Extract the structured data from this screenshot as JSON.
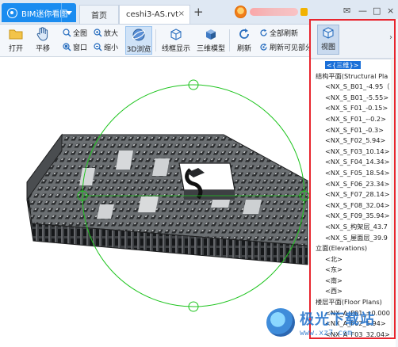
{
  "colors": {
    "accent": "#1a8cf0",
    "highlight_border": "#e8252e",
    "selection": "#1a6fd8",
    "nav_circle": "#1ec41e"
  },
  "titlebar": {
    "app_title": "BIM迷你看图",
    "tabs": [
      {
        "label": "首页"
      },
      {
        "label": "ceshi3-AS.rvt"
      }
    ],
    "add_tab_label": "+",
    "close_label": "×",
    "dropdown_icon": "chevron-down-icon",
    "window_controls": [
      "—",
      "□",
      "×"
    ]
  },
  "toolbar": {
    "open": "打开",
    "pan": "平移",
    "fit_all": "全图",
    "window_zoom": "窗口",
    "zoom_in": "放大",
    "zoom_out": "缩小",
    "browse_3d": "3D浏览",
    "wireframe": "线框显示",
    "model_3d": "三维模型",
    "refresh": "刷新",
    "refresh_all": "全部刷新",
    "refresh_visible": "刷新可见部分"
  },
  "panel": {
    "view_button": "视图",
    "expand_arrow": "›",
    "tree": [
      {
        "kind": "item",
        "label": "<{三维}>",
        "selected": true
      },
      {
        "kind": "group",
        "label": "结构平面(Structural Pla"
      },
      {
        "kind": "item",
        "label": "<NX_S_B01_-4.95（"
      },
      {
        "kind": "item",
        "label": "<NX_S_B01_-5.55>"
      },
      {
        "kind": "item",
        "label": "<NX_S_F01_-0.15>"
      },
      {
        "kind": "item",
        "label": "<NX_S_F01_--0.2>"
      },
      {
        "kind": "item",
        "label": "<NX_S_F01_-0.3>"
      },
      {
        "kind": "item",
        "label": "<NX_S_F02_5.94>"
      },
      {
        "kind": "item",
        "label": "<NX_S_F03_10.14>"
      },
      {
        "kind": "item",
        "label": "<NX_S_F04_14.34>"
      },
      {
        "kind": "item",
        "label": "<NX_S_F05_18.54>"
      },
      {
        "kind": "item",
        "label": "<NX_S_F06_23.34>"
      },
      {
        "kind": "item",
        "label": "<NX_S_F07_28.14>"
      },
      {
        "kind": "item",
        "label": "<NX_S_F08_32.04>"
      },
      {
        "kind": "item",
        "label": "<NX_S_F09_35.94>"
      },
      {
        "kind": "item",
        "label": "<NX_S_构架层_43.7"
      },
      {
        "kind": "item",
        "label": "<NX_S_屋面层_39.9"
      },
      {
        "kind": "group",
        "label": "立面(Elevations)"
      },
      {
        "kind": "item",
        "label": "<北>"
      },
      {
        "kind": "item",
        "label": "<东>"
      },
      {
        "kind": "item",
        "label": "<南>"
      },
      {
        "kind": "item",
        "label": "<西>"
      },
      {
        "kind": "group",
        "label": "楼层平面(Floor Plans)"
      },
      {
        "kind": "item",
        "label": "<NX_A_F01_±0.000"
      },
      {
        "kind": "item",
        "label": "<NX_A_F02_5.94>"
      },
      {
        "kind": "item",
        "label": "<NX_A_F03_32.04>"
      }
    ]
  },
  "watermark": {
    "main": "极光下载站",
    "sub": "www.xz7.com"
  }
}
